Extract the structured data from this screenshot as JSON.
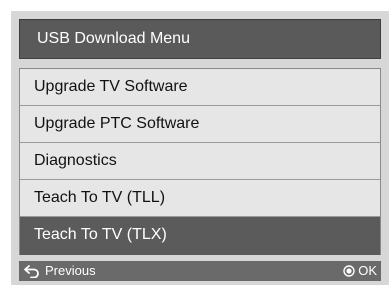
{
  "menu": {
    "title": "USB Download Menu",
    "items": [
      {
        "label": "Upgrade TV Software"
      },
      {
        "label": "Upgrade PTC Software"
      },
      {
        "label": "Diagnostics"
      },
      {
        "label": "Teach To TV (TLL)"
      },
      {
        "label": "Teach To TV (TLX)"
      }
    ],
    "selected_index": 4
  },
  "footer": {
    "previous_label": "Previous",
    "previous_icon": "back-arrow-icon",
    "ok_label": "OK",
    "ok_icon": "ok-circle-icon"
  },
  "colors": {
    "frame_background": "#d7d7d7",
    "header_background": "#5a5a5a",
    "selected_background": "#5b5b5b",
    "item_background": "#e6e6e6",
    "footer_background": "#6a6a6a"
  }
}
